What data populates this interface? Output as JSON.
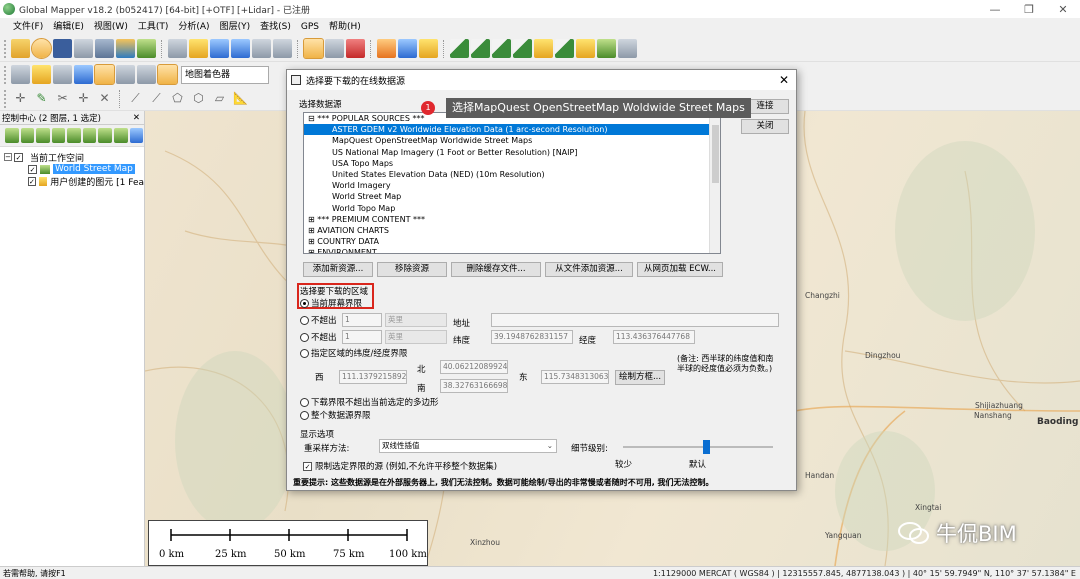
{
  "window": {
    "title": "Global Mapper v18.2 (b052417) [64-bit] [+OTF] [+Lidar] - 已注册",
    "minimize": "—",
    "restore": "❐",
    "close": "✕"
  },
  "menu": [
    "文件(F)",
    "编辑(E)",
    "视图(W)",
    "工具(T)",
    "分析(A)",
    "图层(Y)",
    "查找(S)",
    "GPS",
    "帮助(H)"
  ],
  "toolbar": {
    "shader_select": "地图着色器"
  },
  "control_center": {
    "header": "控制中心 (2 图层, 1 选定)",
    "close": "✕",
    "tree": {
      "root": "当前工作空间",
      "layer1": "World Street Map",
      "layer2": "用户创建的图元 [1 Fea"
    }
  },
  "map": {
    "labels": [
      "Xinzhou",
      "Shijiazhuang",
      "Baoding",
      "Handan",
      "Dingzhou",
      "Xingtai",
      "Changzhi",
      "Yangquan",
      "Nanshang"
    ],
    "scalebar": [
      "0 km",
      "25 km",
      "50 km",
      "75 km",
      "100 km"
    ]
  },
  "statusbar": {
    "left": "若需帮助, 请按F1",
    "right": "1:1129000  MERCAT ( WGS84 ) | 12315557.845, 4877138.043 ) | 40° 15' 59.7949\" N, 110° 37' 57.1384\" E"
  },
  "watermark": "牛侃BIM",
  "dialog": {
    "title": "选择要下载的在线数据源",
    "close": "✕",
    "source_label": "选择数据源",
    "connect": "连接",
    "close_btn": "关闭",
    "sources": [
      {
        "text": "⊟ *** POPULAR SOURCES ***",
        "indent": 0
      },
      {
        "text": "ASTER GDEM v2 Worldwide Elevation Data (1 arc-second Resolution)",
        "indent": 1,
        "selected": true
      },
      {
        "text": "MapQuest OpenStreetMap Worldwide Street Maps",
        "indent": 1
      },
      {
        "text": "US National Map Imagery (1 Foot or Better Resolution) [NAIP]",
        "indent": 1
      },
      {
        "text": "USA Topo Maps",
        "indent": 1
      },
      {
        "text": "United States Elevation Data (NED) (10m Resolution)",
        "indent": 1
      },
      {
        "text": "World Imagery",
        "indent": 1
      },
      {
        "text": "World Street Map",
        "indent": 1
      },
      {
        "text": "World Topo Map",
        "indent": 1
      },
      {
        "text": "⊞ *** PREMIUM CONTENT ***",
        "indent": 0
      },
      {
        "text": "⊞ AVIATION CHARTS",
        "indent": 0
      },
      {
        "text": "⊞ COUNTRY DATA",
        "indent": 0
      },
      {
        "text": "⊞ ENVIRONMENT",
        "indent": 0
      }
    ],
    "buttons": [
      "添加新资源...",
      "移除资源",
      "删除缓存文件...",
      "从文件添加资源...",
      "从网页加载 ECW..."
    ],
    "area_label": "选择要下载的区域",
    "opt_current": "当前屏幕界限",
    "opt_within1": "不超出",
    "opt_within1_val": "1",
    "opt_within1_unit": "英里",
    "address_label": "地址",
    "opt_within2": "不超出",
    "opt_within2_val": "1",
    "opt_within2_unit": "英里",
    "lat_label": "纬度",
    "lat_val": "39.1948762831157",
    "lon_label": "经度",
    "lon_val": "113.436376447768",
    "opt_bounds": "指定区域的纬度/经度界限",
    "note": "(备注: 西半球的纬度值和南半球的经度值必须为负数。)",
    "north_label": "北",
    "north_val": "40.0621208992462",
    "west_label": "西",
    "west_val": "111.137921589205",
    "east_label": "东",
    "east_val": "115.734831306326",
    "south_label": "南",
    "south_val": "38.3276316669852",
    "draw_box": "绘制方框...",
    "opt_polygon": "下载界限不超出当前选定的多边形",
    "opt_full": "整个数据源界限",
    "display_label": "显示选项",
    "resample_label": "重采样方法:",
    "resample_val": "双线性插值",
    "detail_label": "细节级别:",
    "detail_value": 0.55,
    "less": "较少",
    "default": "默认",
    "clamp_label": "限制选定界限的源 (例如,不允许平移整个数据集)",
    "warning": "重要提示: 这些数据源是在外部服务器上, 我们无法控制。数据可能绘制/导出的非常慢或者随时不可用, 我们无法控制。"
  },
  "annotation": {
    "badge": "1",
    "callout": "选择MapQuest OpenStreetMap Woldwide Street Maps"
  }
}
